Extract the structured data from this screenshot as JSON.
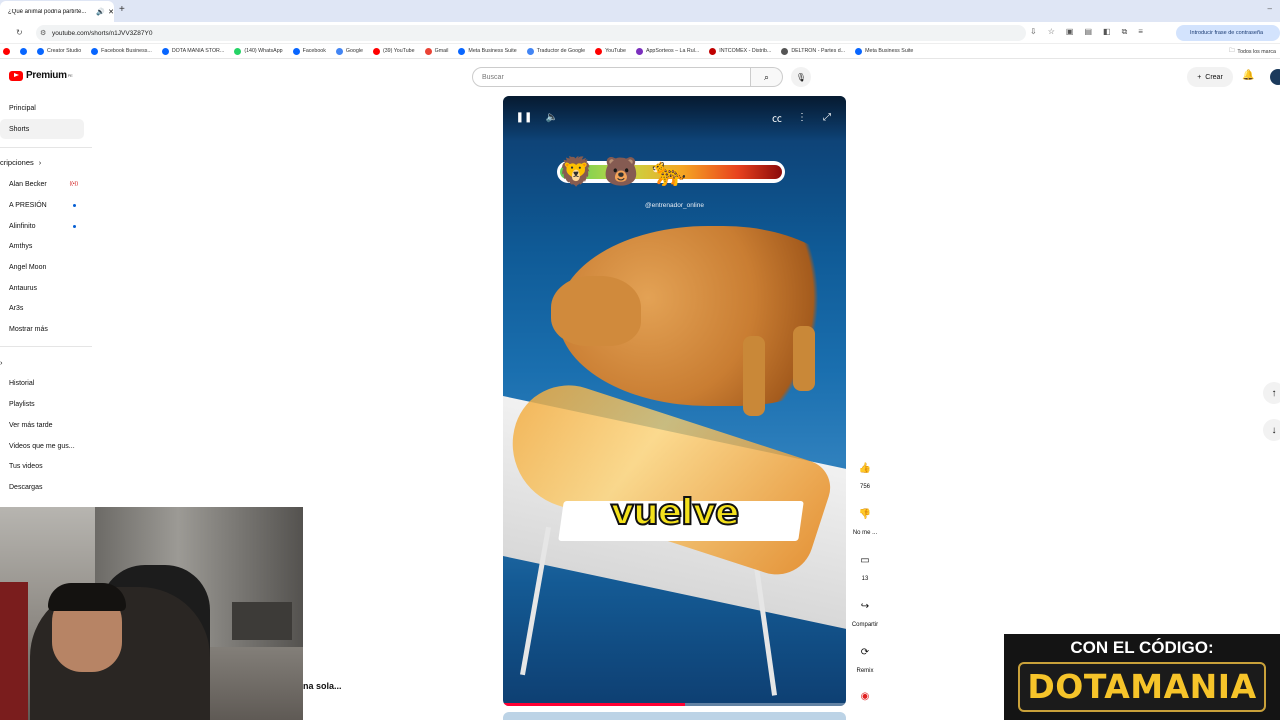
{
  "browser": {
    "tab_title": "¿Qué animal podría partirte...",
    "url": "youtube.com/shorts/n1JVV3Z87Y0",
    "password_chip": "Introducir frase de contraseña",
    "bookmarks": [
      {
        "label": "Creator Studio",
        "color": "#ff0000"
      },
      {
        "label": "Facebook Business...",
        "color": "#0866ff"
      },
      {
        "label": "DOTA MANIA STOR...",
        "color": "#0866ff"
      },
      {
        "label": "(140) WhatsApp",
        "color": "#25d366"
      },
      {
        "label": "Facebook",
        "color": "#0866ff"
      },
      {
        "label": "Google",
        "color": "#4285f4"
      },
      {
        "label": "(39) YouTube",
        "color": "#ff0000"
      },
      {
        "label": "Gmail",
        "color": "#ea4335"
      },
      {
        "label": "Meta Business Suite",
        "color": "#0866ff"
      },
      {
        "label": "Traductor de Google",
        "color": "#4285f4"
      },
      {
        "label": "YouTube",
        "color": "#ff0000"
      },
      {
        "label": "AppSorteos – La Rul...",
        "color": "#7b2fbe"
      },
      {
        "label": "INTCOMEX - Distrib...",
        "color": "#c00000"
      },
      {
        "label": "DELTRON - Partes d...",
        "color": "#555555"
      },
      {
        "label": "Meta Business Suite",
        "color": "#0866ff"
      }
    ],
    "all_bookmarks": "Todos los marca"
  },
  "header": {
    "logo_text": "Premium",
    "logo_sup": "PE",
    "search_placeholder": "Buscar",
    "create_label": "Crear"
  },
  "sidebar": {
    "main": [
      {
        "label": "Principal"
      },
      {
        "label": "Shorts"
      }
    ],
    "subscriptions_title": "cripciones",
    "subscriptions": [
      {
        "label": "Alan Becker",
        "live": "((•))"
      },
      {
        "label": "A PRESIÓN",
        "dot": true
      },
      {
        "label": "Alinfinito",
        "dot": true
      },
      {
        "label": "Amthys"
      },
      {
        "label": "Angel Moon"
      },
      {
        "label": "Antaurus"
      },
      {
        "label": "Ar3s"
      },
      {
        "label": "Mostrar más"
      }
    ],
    "you": [
      {
        "label": "Historial"
      },
      {
        "label": "Playlists"
      },
      {
        "label": "Ver más tarde"
      },
      {
        "label": "Videos que me gus..."
      },
      {
        "label": "Tus videos"
      },
      {
        "label": "Descargas"
      }
    ]
  },
  "player": {
    "handle": "@entrenador_online",
    "subtitle": "vuelve",
    "emojis": [
      "🦁",
      "🐻",
      "🐆"
    ],
    "progress": 0.53
  },
  "actions": {
    "like_count": "756",
    "dislike_label": "No me ...",
    "comments_count": "13",
    "share_label": "Compartir",
    "remix_label": "Remix"
  },
  "overlay": {
    "caption_left": "na sola...",
    "promo_line1": "CON EL CÓDIGO:",
    "promo_line2": "DOTAMANIA"
  }
}
